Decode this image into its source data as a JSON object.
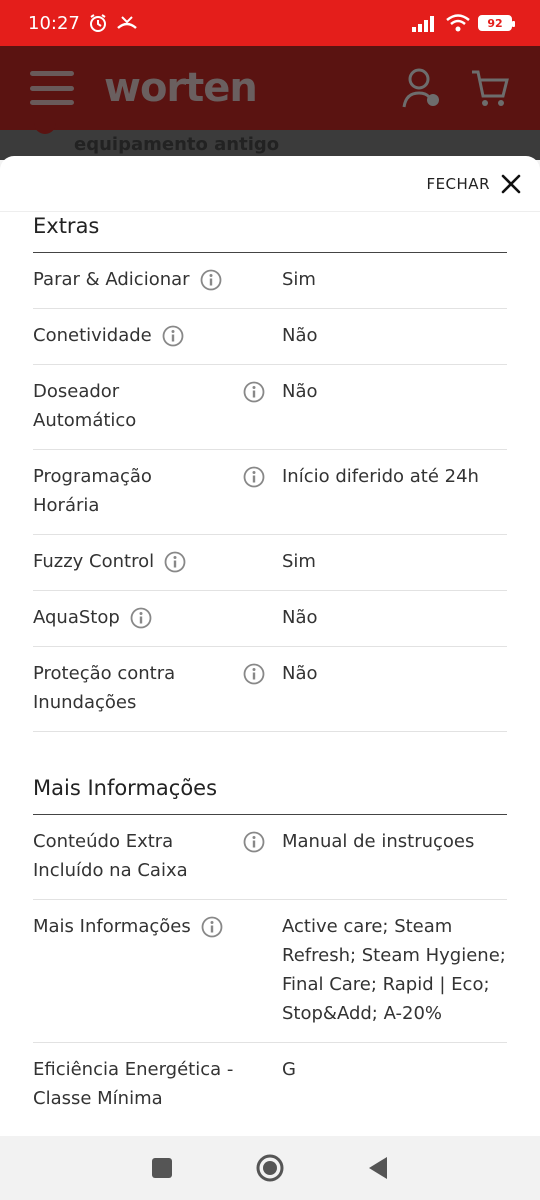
{
  "status_bar": {
    "time": "10:27",
    "battery": "92"
  },
  "header": {
    "logo": "worten",
    "behind_text": "equipamento antigo"
  },
  "modal": {
    "close_label": "FECHAR"
  },
  "extras": {
    "title": "Extras",
    "rows": [
      {
        "label": "Parar & Adicionar",
        "value": "Sim"
      },
      {
        "label": "Conetividade",
        "value": "Não"
      },
      {
        "label": "Doseador Automático",
        "value": "Não"
      },
      {
        "label": "Programação Horária",
        "value": "Início diferido até 24h"
      },
      {
        "label": "Fuzzy Control",
        "value": "Sim"
      },
      {
        "label": "AquaStop",
        "value": "Não"
      },
      {
        "label": "Proteção contra Inundações",
        "value": "Não"
      }
    ]
  },
  "more_info": {
    "title": "Mais Informações",
    "rows": [
      {
        "label": "Conteúdo Extra Incluído na Caixa",
        "value": "Manual de instruçoes"
      },
      {
        "label": "Mais Informações",
        "value": "Active care; Steam Refresh; Steam Hygiene; Final Care; Rapid | Eco; Stop&Add; A-20%"
      },
      {
        "label": "Eficiência Energética - Classe Mínima",
        "value": "G"
      }
    ]
  },
  "icons": {
    "info": "info-icon",
    "close": "close-icon",
    "alarm": "alarm-icon",
    "signal": "signal-icon",
    "wifi": "wifi-icon",
    "user": "user-icon",
    "cart": "cart-icon"
  },
  "colors": {
    "brand_red": "#e41e1b",
    "header_dimmed": "#5a1311"
  }
}
